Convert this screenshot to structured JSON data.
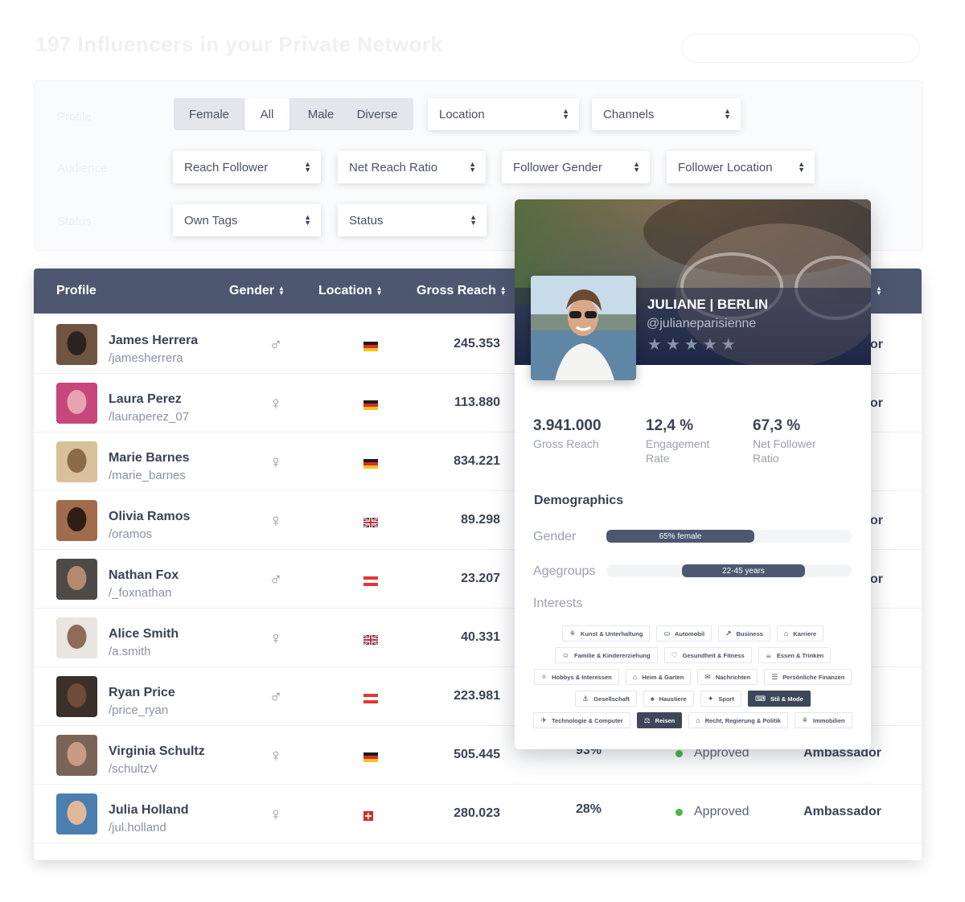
{
  "page": {
    "title": "197 Influencers in your Private Network"
  },
  "filters": {
    "row_labels": [
      "Profile",
      "Audience",
      "Status"
    ],
    "gender_segments": [
      "Female",
      "All",
      "Male",
      "Diverse"
    ],
    "gender_selected": "All",
    "location": "Location",
    "channels": "Channels",
    "reach_follower": "Reach Follower",
    "net_reach_ratio": "Net Reach Ratio",
    "follower_gender": "Follower Gender",
    "follower_location": "Follower Location",
    "own_tags": "Own Tags",
    "status": "Status"
  },
  "table": {
    "columns": [
      "Profile",
      "Gender",
      "Location",
      "Gross Reach"
    ],
    "rows": [
      {
        "name": "James Herrera",
        "handle": "/jamesherrera",
        "gender": "male",
        "flag": "de",
        "reach": "245.353",
        "ratio": "",
        "status": "",
        "tag": "",
        "tail": "or"
      },
      {
        "name": "Laura Perez",
        "handle": "/lauraperez_07",
        "gender": "female",
        "flag": "de",
        "reach": "113.880",
        "ratio": "",
        "status": "",
        "tag": "",
        "tail": "or"
      },
      {
        "name": "Marie Barnes",
        "handle": "/marie_barnes",
        "gender": "female",
        "flag": "de",
        "reach": "834.221",
        "ratio": "",
        "status": "",
        "tag": "",
        "tail": ""
      },
      {
        "name": "Olivia Ramos",
        "handle": "/oramos",
        "gender": "female",
        "flag": "uk",
        "reach": "89.298",
        "ratio": "",
        "status": "",
        "tag": "",
        "tail": "or"
      },
      {
        "name": "Nathan Fox",
        "handle": "/_foxnathan",
        "gender": "male",
        "flag": "at",
        "reach": "23.207",
        "ratio": "",
        "status": "",
        "tag": "",
        "tail": "or"
      },
      {
        "name": "Alice Smith",
        "handle": "/a.smith",
        "gender": "female",
        "flag": "uk",
        "reach": "40.331",
        "ratio": "",
        "status": "",
        "tag": "",
        "tail": ""
      },
      {
        "name": "Ryan Price",
        "handle": "/price_ryan",
        "gender": "male",
        "flag": "at",
        "reach": "223.981",
        "ratio": "",
        "status": "",
        "tag": "",
        "tail": ""
      },
      {
        "name": "Virginia Schultz",
        "handle": "/schultzV",
        "gender": "female",
        "flag": "de",
        "reach": "505.445",
        "ratio": "93%",
        "status": "Approved",
        "tag": "Ambassador",
        "tail": ""
      },
      {
        "name": "Julia Holland",
        "handle": "/jul.holland",
        "gender": "female",
        "flag": "ch",
        "reach": "280.023",
        "ratio": "28%",
        "status": "Approved",
        "tag": "Ambassador",
        "tail": ""
      }
    ]
  },
  "popup": {
    "name": "JULIANE | BERLIN",
    "handle": "@julianeparisienne",
    "stars": 5,
    "stats": [
      {
        "value": "3.941.000",
        "label": "Gross Reach"
      },
      {
        "value": "12,4 %",
        "label": "Engagement Rate"
      },
      {
        "value": "67,3 %",
        "label": "Net Follower Ratio"
      }
    ],
    "demographics_title": "Demographics",
    "gender_label": "Gender",
    "gender_bar": "65% female",
    "gender_share": 0.65,
    "age_label": "Agegroups",
    "age_bar": "22-45 years",
    "interests_label": "Interests",
    "interests": [
      [
        {
          "label": "Kunst & Unterhaltung",
          "active": false
        },
        {
          "label": "Automobil",
          "active": false
        },
        {
          "label": "Business",
          "active": false
        },
        {
          "label": "Karriere",
          "active": false
        }
      ],
      [
        {
          "label": "Familie & Kindererziehung",
          "active": false
        },
        {
          "label": "Gesundheit & Fitness",
          "active": false
        },
        {
          "label": "Essen & Trinken",
          "active": false
        }
      ],
      [
        {
          "label": "Hobbys & Interessen",
          "active": false
        },
        {
          "label": "Heim & Garten",
          "active": false
        },
        {
          "label": "Nachrichten",
          "active": false
        },
        {
          "label": "Persönliche Finanzen",
          "active": false
        }
      ],
      [
        {
          "label": "Gesellschaft",
          "active": false
        },
        {
          "label": "Haustiere",
          "active": false
        },
        {
          "label": "Sport",
          "active": false
        },
        {
          "label": "Stil & Mode",
          "active": true
        }
      ],
      [
        {
          "label": "Technologie & Computer",
          "active": false
        },
        {
          "label": "Reisen",
          "active": true
        },
        {
          "label": "Recht, Regierung & Politik",
          "active": false
        },
        {
          "label": "Immobilien",
          "active": false
        }
      ]
    ]
  },
  "colors": {
    "header_bg": "#4d5770",
    "approved": "#49b849",
    "text_dark": "#3a4256",
    "text_muted": "#8a91a1"
  }
}
